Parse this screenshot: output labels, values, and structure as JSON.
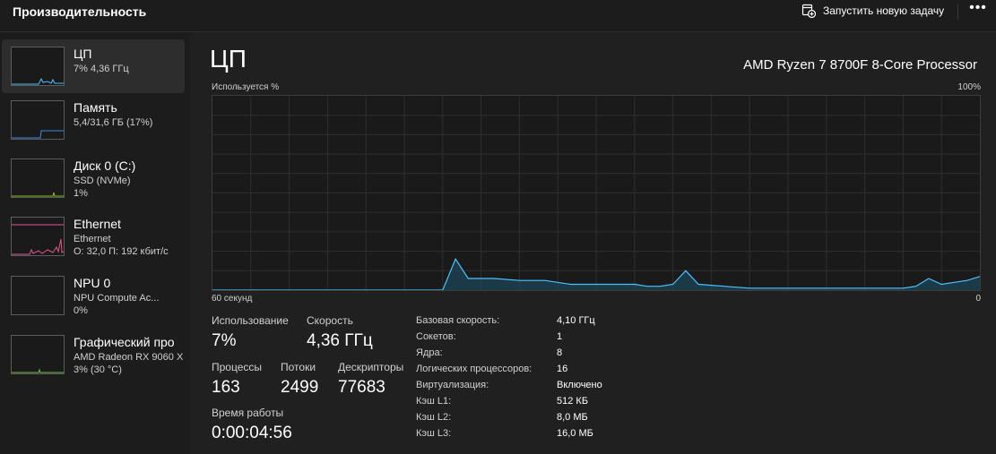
{
  "header": {
    "title": "Производительность",
    "run_task_label": "Запустить новую задачу",
    "more_label": "•••",
    "run_task_icon": "new-task-icon"
  },
  "sidebar": {
    "items": [
      {
        "title": "ЦП",
        "line1": "7% 4,36 ГГц",
        "line2": "",
        "color": "#4cc2ff"
      },
      {
        "title": "Память",
        "line1": "5,4/31,6 ГБ (17%)",
        "line2": "",
        "color": "#3a8ee6"
      },
      {
        "title": "Диск 0 (C:)",
        "line1": "SSD (NVMe)",
        "line2": "1%",
        "color": "#8cbf26"
      },
      {
        "title": "Ethernet",
        "line1": "Ethernet",
        "line2": "О: 32,0 П: 192 кбит/с",
        "color": "#e3568d"
      },
      {
        "title": "NPU 0",
        "line1": "NPU Compute Ac...",
        "line2": "0%",
        "color": "#4cc2ff"
      },
      {
        "title": "Графический про",
        "line1": "AMD Radeon RX 9060 X",
        "line2": "3% (30 °C)",
        "color": "#6fbf4c"
      }
    ]
  },
  "main": {
    "title": "ЦП",
    "model": "AMD Ryzen 7 8700F 8-Core Processor",
    "graph": {
      "top_left": "Используется %",
      "top_right": "100%",
      "bottom_left": "60 секунд",
      "bottom_right": "0",
      "line_color": "#4cc2ff",
      "fill_color": "#1e4f66"
    },
    "stats": {
      "usage_label": "Использование",
      "usage_value": "7%",
      "speed_label": "Скорость",
      "speed_value": "4,36 ГГц",
      "processes_label": "Процессы",
      "processes_value": "163",
      "threads_label": "Потоки",
      "threads_value": "2499",
      "handles_label": "Дескрипторы",
      "handles_value": "77683",
      "uptime_label": "Время работы",
      "uptime_value": "0:00:04:56"
    },
    "info": [
      {
        "label": "Базовая скорость:",
        "value": "4,10 ГГц"
      },
      {
        "label": "Сокетов:",
        "value": "1"
      },
      {
        "label": "Ядра:",
        "value": "8"
      },
      {
        "label": "Логических процессоров:",
        "value": "16"
      },
      {
        "label": "Виртуализация:",
        "value": "Включено"
      },
      {
        "label": "Кэш L1:",
        "value": "512 КБ"
      },
      {
        "label": "Кэш L2:",
        "value": "8,0 МБ"
      },
      {
        "label": "Кэш L3:",
        "value": "16,0 МБ"
      }
    ]
  },
  "chart_data": {
    "type": "area",
    "title": "",
    "xlabel": "",
    "ylabel": "Используется %",
    "xlim": [
      60,
      0
    ],
    "ylim": [
      0,
      100
    ],
    "grid": true,
    "x": [
      60,
      44,
      43,
      42,
      41,
      40,
      38,
      36,
      34,
      32,
      30,
      28,
      27,
      26,
      25,
      24,
      23,
      22,
      20,
      18,
      16,
      14,
      12,
      10,
      8,
      6,
      5,
      4,
      3,
      2,
      1,
      0
    ],
    "series": [
      {
        "values": [
          0,
          0,
          0,
          0,
          16,
          6,
          6,
          5,
          5,
          3,
          3,
          3,
          3,
          2,
          2,
          3,
          10,
          3,
          2,
          1,
          1,
          1,
          1,
          1,
          1,
          1,
          2,
          6,
          3,
          4,
          5,
          7
        ]
      }
    ]
  }
}
